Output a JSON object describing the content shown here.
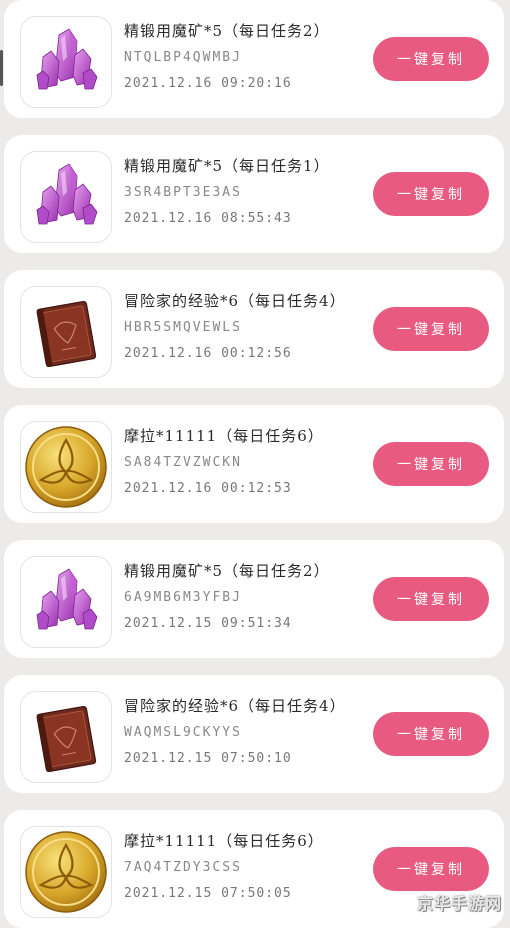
{
  "items": [
    {
      "title": "精锻用魔矿*5（每日任务2）",
      "code": "NTQLBP4QWMBJ",
      "time": "2021.12.16 09:20:16",
      "button": "一键复制",
      "icon": "crystal-icon"
    },
    {
      "title": "精锻用魔矿*5（每日任务1）",
      "code": "3SR4BPT3E3AS",
      "time": "2021.12.16 08:55:43",
      "button": "一键复制",
      "icon": "crystal-icon"
    },
    {
      "title": "冒险家的经验*6（每日任务4）",
      "code": "HBR5SMQVEWLS",
      "time": "2021.12.16 00:12:56",
      "button": "一键复制",
      "icon": "book-icon"
    },
    {
      "title": "摩拉*11111（每日任务6）",
      "code": "SA84TZVZWCKN",
      "time": "2021.12.16 00:12:53",
      "button": "一键复制",
      "icon": "coin-icon"
    },
    {
      "title": "精锻用魔矿*5（每日任务2）",
      "code": "6A9MB6M3YFBJ",
      "time": "2021.12.15 09:51:34",
      "button": "一键复制",
      "icon": "crystal-icon"
    },
    {
      "title": "冒险家的经验*6（每日任务4）",
      "code": "WAQMSL9CKYYS",
      "time": "2021.12.15 07:50:10",
      "button": "一键复制",
      "icon": "book-icon"
    },
    {
      "title": "摩拉*11111（每日任务6）",
      "code": "7AQ4TZDY3CSS",
      "time": "2021.12.15 07:50:05",
      "button": "一键复制",
      "icon": "coin-icon"
    }
  ],
  "watermark": "京华手游网",
  "colors": {
    "button": "#e85a7f",
    "background": "#ecebea",
    "card": "#ffffff"
  }
}
